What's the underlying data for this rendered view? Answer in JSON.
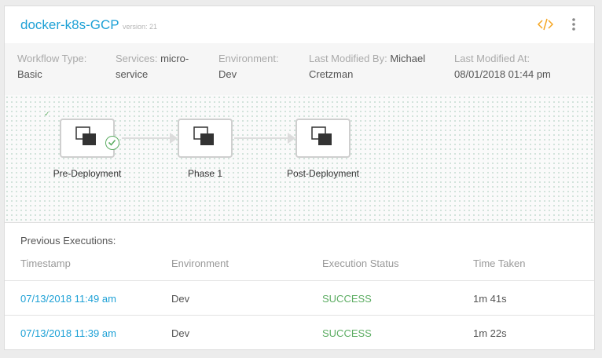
{
  "header": {
    "title": "docker-k8s-GCP",
    "version": "version: 21",
    "code_icon": "code-brackets-icon",
    "menu_icon": "vertical-dots-icon"
  },
  "meta": {
    "workflow_type_label": "Workflow Type:",
    "workflow_type_value": "Basic",
    "services_label": "Services:",
    "services_value": "micro-service",
    "environment_label": "Environment:",
    "environment_value": "Dev",
    "modified_by_label": "Last Modified By:",
    "modified_by_value": "Michael Cretzman",
    "modified_at_label": "Last Modified At:",
    "modified_at_value": "08/01/2018 01:44 pm"
  },
  "pipeline": {
    "stages": [
      {
        "label": "Pre-Deployment",
        "status": "success"
      },
      {
        "label": "Phase 1"
      },
      {
        "label": "Post-Deployment"
      }
    ]
  },
  "executions": {
    "title": "Previous Executions:",
    "columns": [
      "Timestamp",
      "Environment",
      "Execution Status",
      "Time Taken"
    ],
    "rows": [
      {
        "timestamp": "07/13/2018 11:49 am",
        "environment": "Dev",
        "status": "SUCCESS",
        "time": "1m 41s"
      },
      {
        "timestamp": "07/13/2018 11:39 am",
        "environment": "Dev",
        "status": "SUCCESS",
        "time": "1m 22s"
      }
    ]
  },
  "colors": {
    "accent": "#1ea1d6",
    "success": "#5dad63",
    "code_icon": "#f5a623"
  }
}
